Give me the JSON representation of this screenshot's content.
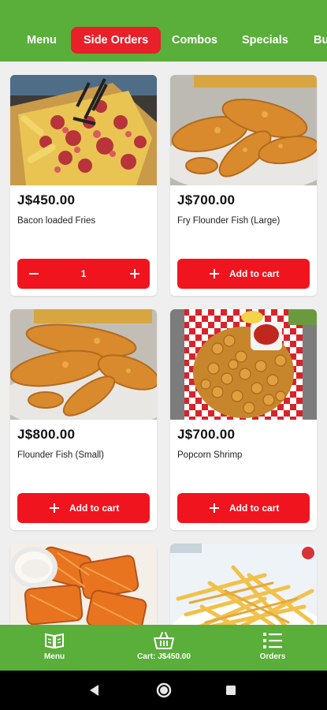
{
  "categories": [
    {
      "label": "Menu",
      "active": false
    },
    {
      "label": "Side Orders",
      "active": true
    },
    {
      "label": "Combos",
      "active": false
    },
    {
      "label": "Specials",
      "active": false
    },
    {
      "label": "Bu",
      "active": false
    }
  ],
  "colors": {
    "brand_green": "#5aae3a",
    "accent_red": "#f0141e",
    "active_tab": "#e8202a",
    "background": "#efefef"
  },
  "products": [
    {
      "price": "J$450.00",
      "name": "Bacon loaded Fries",
      "in_cart": true,
      "quantity": "1",
      "image": "bacon-loaded-fries-photo"
    },
    {
      "price": "J$700.00",
      "name": "Fry Flounder Fish (Large)",
      "in_cart": false,
      "add_label": "Add to cart",
      "image": "fried-flounder-photo"
    },
    {
      "price": "J$800.00",
      "name": "Flounder Fish (Small)",
      "in_cart": false,
      "add_label": "Add to cart",
      "image": "fried-flounder-photo"
    },
    {
      "price": "J$700.00",
      "name": "Popcorn Shrimp",
      "in_cart": false,
      "add_label": "Add to cart",
      "image": "popcorn-shrimp-photo"
    },
    {
      "image": "waffle-fries-photo"
    },
    {
      "image": "french-fries-photo"
    }
  ],
  "bottom_nav": {
    "menu": {
      "label": "Menu",
      "icon": "book-icon"
    },
    "cart": {
      "label": "Cart: J$450.00",
      "icon": "basket-icon"
    },
    "orders": {
      "label": "Orders",
      "icon": "list-icon"
    }
  },
  "system_nav": {
    "back": "back-icon",
    "home": "home-icon",
    "recents": "recents-icon"
  }
}
